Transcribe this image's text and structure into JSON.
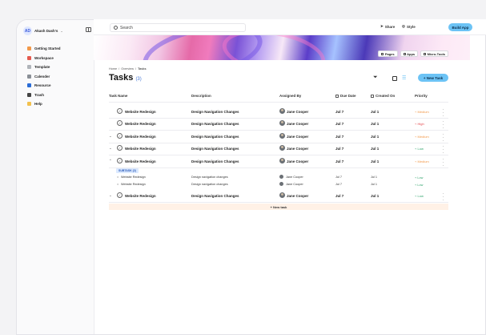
{
  "workspace": {
    "initials": "AD",
    "name": "Akash Dash's"
  },
  "sidebar": {
    "items": [
      {
        "label": "Getting Started",
        "icon": "rocket-icon",
        "color": "#f2994a"
      },
      {
        "label": "Workspace",
        "icon": "grid-icon",
        "color": "#e55a4f"
      },
      {
        "label": "Template",
        "icon": "template-icon",
        "color": "#b0b4ba"
      },
      {
        "label": "Calender",
        "icon": "calendar-icon",
        "color": "#8a8f96"
      },
      {
        "label": "Resource",
        "icon": "globe-icon",
        "color": "#2b6cd6"
      },
      {
        "label": "Trash",
        "icon": "trash-icon",
        "color": "#444"
      },
      {
        "label": "Help",
        "icon": "help-icon",
        "color": "#f2c14e"
      }
    ]
  },
  "topbar": {
    "search_placeholder": "Search",
    "share": "Share",
    "style": "Style",
    "build": "Build App"
  },
  "banner_chips": [
    "Pages",
    "Apps",
    "Micro-Tools"
  ],
  "breadcrumb": [
    "Home",
    "Overview",
    "Tasks"
  ],
  "page": {
    "title": "Tasks",
    "count": "(3)",
    "new_task": "+ New Task"
  },
  "columns": {
    "name": "Task Name",
    "description": "Description",
    "assigned": "Assigned By",
    "due": "Due Date",
    "created": "Created On",
    "priority": "Priority"
  },
  "rows": [
    {
      "caret": "",
      "name": "Website Redesign",
      "description": "Design Navigation Changes",
      "assignee": "Jane Cooper",
      "due": "Jul 7",
      "created": "Jul 1",
      "priority": "Medium",
      "pcolor": "#f2994a"
    },
    {
      "caret": "",
      "name": "Website Redesign",
      "description": "Design Navigation Changes",
      "assignee": "Jane Cooper",
      "due": "Jul 7",
      "created": "Jul 1",
      "priority": "High",
      "pcolor": "#e5484d"
    },
    {
      "caret": "⌄",
      "name": "Website Redesign",
      "description": "Design Navigation Changes",
      "assignee": "Jane Cooper",
      "due": "Jul 7",
      "created": "Jul 1",
      "priority": "Medium",
      "pcolor": "#f2994a"
    },
    {
      "caret": "⌄",
      "name": "Website Redesign",
      "description": "Design Navigation Changes",
      "assignee": "Jane Cooper",
      "due": "Jul 7",
      "created": "Jul 1",
      "priority": "Low",
      "pcolor": "#30a46c"
    },
    {
      "caret": "⌃",
      "name": "Website Redesign",
      "description": "Design Navigation Changes",
      "assignee": "Jane Cooper",
      "due": "Jul 7",
      "created": "Jul 1",
      "priority": "Medium",
      "pcolor": "#f2994a"
    }
  ],
  "subtask_badge": "SUBTASK (2)",
  "subtasks": [
    {
      "name": "Website Redesign",
      "description": "Design navigation changes",
      "assignee": "Jane Cooper",
      "due": "Jul 7",
      "created": "Jul 1",
      "priority": "Low"
    },
    {
      "name": "Website Redesign",
      "description": "Design navigation changes",
      "assignee": "Jane Cooper",
      "due": "Jul 7",
      "created": "Jul 1",
      "priority": "Low"
    }
  ],
  "last_row": {
    "caret": "⌄",
    "name": "Website Redesign",
    "description": "Design Navigation Changes",
    "assignee": "Jane Cooper",
    "due": "Jul 7",
    "created": "Jul 1",
    "priority": "Low",
    "pcolor": "#30a46c"
  },
  "add_task": "+ New task"
}
